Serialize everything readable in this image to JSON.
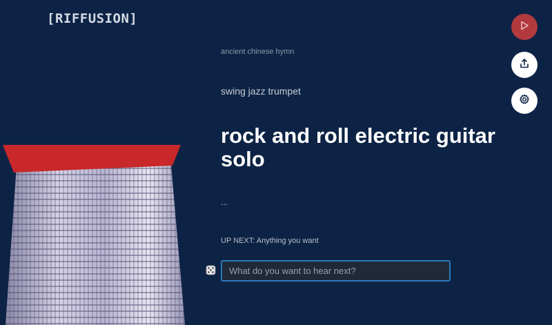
{
  "app": {
    "logo_text": "[RIFFUSION]"
  },
  "prompts": {
    "previous_2": "ancient chinese hymn",
    "previous_1": "swing jazz trumpet",
    "current": "rock and roll electric guitar solo",
    "pending": "..."
  },
  "up_next": {
    "label": "UP NEXT: Anything you want"
  },
  "input": {
    "placeholder": "What do you want to hear next?"
  },
  "icons": {
    "play": "play-icon",
    "share": "share-icon",
    "settings": "gear-icon",
    "dice": "dice-icon"
  },
  "colors": {
    "background": "#0d2345",
    "play_button": "#b23a3f",
    "input_border": "#2a7ab8",
    "spectrogram_top": "#c8282a"
  }
}
